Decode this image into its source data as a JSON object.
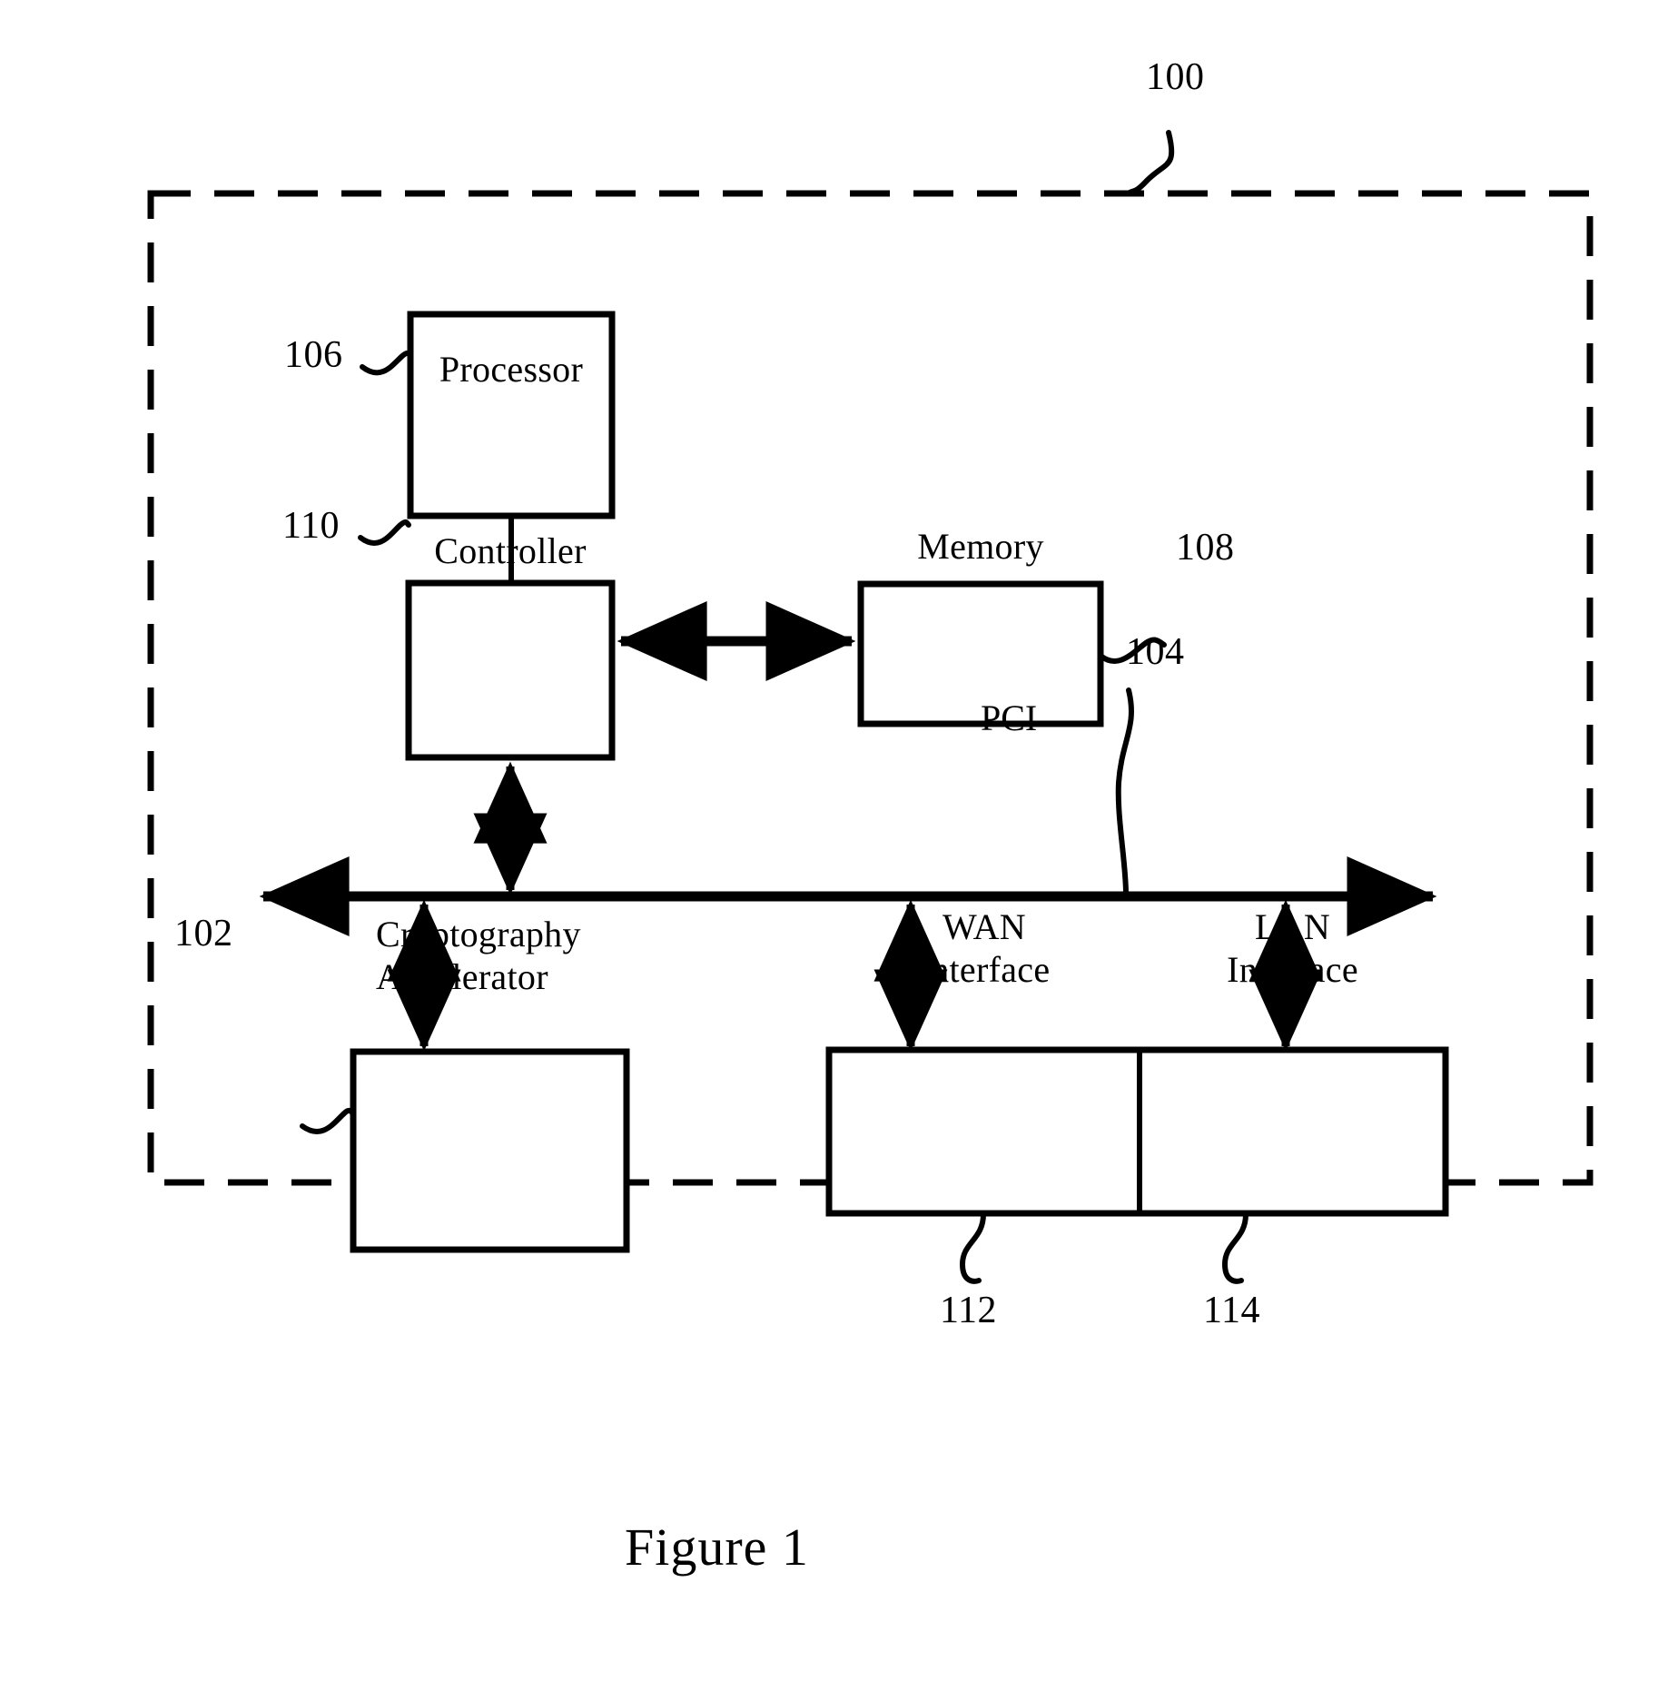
{
  "figure": {
    "caption": "Figure 1",
    "system_ref": "100",
    "outer_boundary_style": "dashed"
  },
  "blocks": [
    {
      "id": "processor",
      "label": "Processor",
      "ref": "106",
      "ref_side": "left"
    },
    {
      "id": "controller",
      "label": "Controller",
      "ref": "110",
      "ref_side": "left"
    },
    {
      "id": "memory",
      "label": "Memory",
      "ref": "108",
      "ref_side": "right"
    },
    {
      "id": "cryptography-accelerator",
      "label": "Cryptography\nAccelerator",
      "ref": "102",
      "ref_side": "left"
    },
    {
      "id": "wan-interface",
      "label": "WAN\nInterface",
      "ref": "112",
      "ref_side": "below"
    },
    {
      "id": "lan-interface",
      "label": "LAN\nInterface",
      "ref": "114",
      "ref_side": "below"
    }
  ],
  "bus": {
    "label": "PCI",
    "ref": "104"
  },
  "connections": [
    {
      "from": "processor",
      "to": "controller",
      "type": "line"
    },
    {
      "from": "controller",
      "to": "memory",
      "type": "double-arrow"
    },
    {
      "from": "controller",
      "to": "bus",
      "type": "double-arrow"
    },
    {
      "from": "cryptography-accelerator",
      "to": "bus",
      "type": "double-arrow"
    },
    {
      "from": "wan-interface",
      "to": "bus",
      "type": "double-arrow"
    },
    {
      "from": "lan-interface",
      "to": "bus",
      "type": "double-arrow"
    }
  ],
  "colors": {
    "ink": "#000000",
    "paper": "#ffffff"
  }
}
